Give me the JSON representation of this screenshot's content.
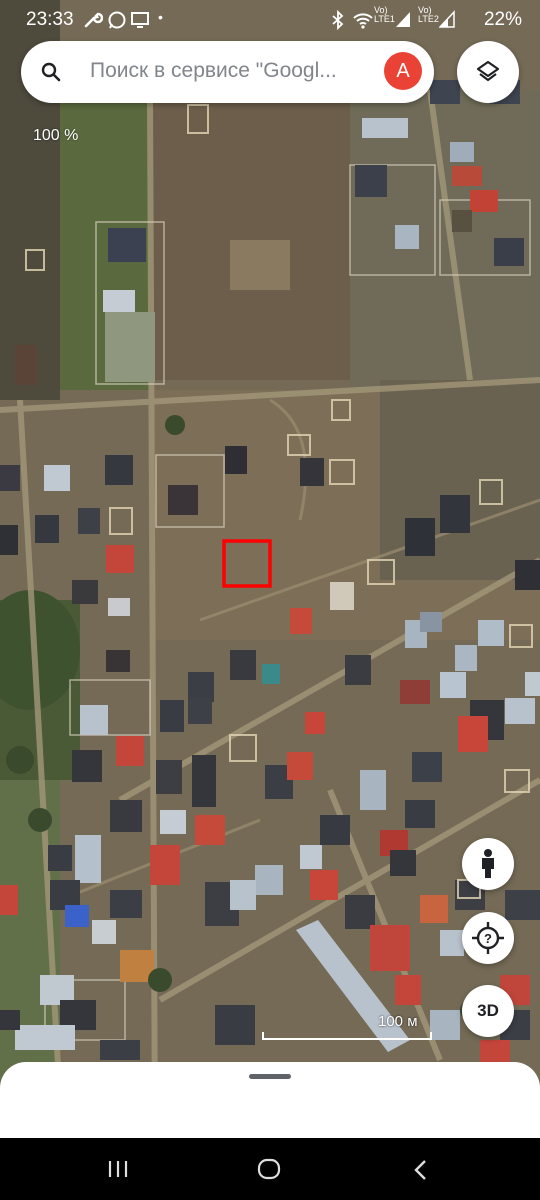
{
  "status_bar": {
    "time": "23:33",
    "dot": "•",
    "network1": "LTE1",
    "network2": "LTE2",
    "battery": "22%",
    "icons": [
      "wrench-icon",
      "whatsapp-icon",
      "cast-icon",
      "bluetooth-icon",
      "wifi-icon",
      "signal-icon",
      "signal-icon",
      "battery-icon"
    ]
  },
  "search": {
    "placeholder": "Поиск в сервисе \"Googl...",
    "avatar_letter": "A",
    "avatar_color": "#ea4335"
  },
  "map": {
    "zoom_label": "100 %",
    "scale_label": "100 м",
    "highlight_color": "#ff0000",
    "three_d_label": "3D"
  },
  "controls": {
    "layers_icon": "layers-icon",
    "street_view_icon": "pegman-icon",
    "location_icon": "location-unknown-icon"
  },
  "nav": {
    "recents_icon": "recents-icon",
    "home_icon": "home-icon",
    "back_icon": "back-icon"
  }
}
